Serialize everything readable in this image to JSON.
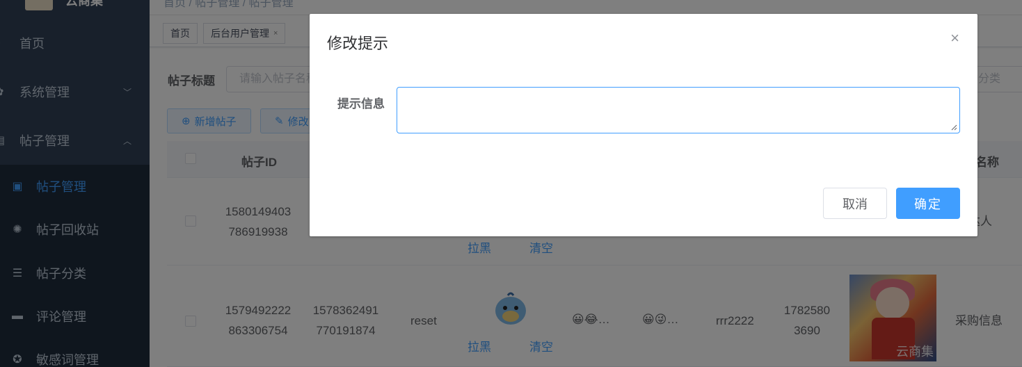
{
  "app": {
    "logo_text": "云商集"
  },
  "sidebar": {
    "items": [
      {
        "label": "首页",
        "icon": "dashboard-icon"
      },
      {
        "label": "系统管理",
        "icon": "gear-icon",
        "arrow": "chevron-down-icon"
      },
      {
        "label": "帖子管理",
        "icon": "document-icon",
        "arrow": "chevron-up-icon"
      }
    ],
    "subitems": [
      {
        "label": "帖子管理",
        "icon": "file-icon",
        "active": true
      },
      {
        "label": "帖子回收站",
        "icon": "bug-icon"
      },
      {
        "label": "帖子分类",
        "icon": "list-icon"
      },
      {
        "label": "评论管理",
        "icon": "comment-icon"
      },
      {
        "label": "敏感词管理",
        "icon": "shield-icon"
      }
    ]
  },
  "breadcrumb": "首页 / 帖子管理 / 帖子管理",
  "tags": [
    {
      "label": "首页"
    },
    {
      "label": "后台用户管理",
      "close": "×"
    }
  ],
  "search": {
    "label": "帖子标题",
    "placeholder": "请输入帖子名称",
    "right_placeholder": "分类"
  },
  "toolbar": {
    "add_label": "新增帖子",
    "edit_label": "修改"
  },
  "table": {
    "headers": {
      "id": "帖子ID",
      "category": "类名称"
    },
    "rows": [
      {
        "id_line1": "1580149403",
        "id_line2": "786919938",
        "block_label": "拉黑",
        "clear_label": "清空",
        "category_fragment": "达人"
      },
      {
        "id_line1": "1579492222",
        "id_line2": "863306754",
        "user_line1": "1578362491",
        "user_line2": "770191874",
        "name": "reset",
        "block_label": "拉黑",
        "clear_label": "清空",
        "emojis_a": "😀😂…",
        "emojis_b": "😀😜…",
        "nickname": "rrr2222",
        "phone_line1": "1782580",
        "phone_line2": "3690",
        "image_watermark": "云商集",
        "category": "采购信息"
      }
    ]
  },
  "dialog": {
    "title": "修改提示",
    "close": "×",
    "field_label": "提示信息",
    "field_value": "",
    "cancel_label": "取消",
    "ok_label": "确定"
  },
  "colors": {
    "primary": "#409eff",
    "sidebar": "#304156",
    "submenu": "#1f2d3d"
  }
}
